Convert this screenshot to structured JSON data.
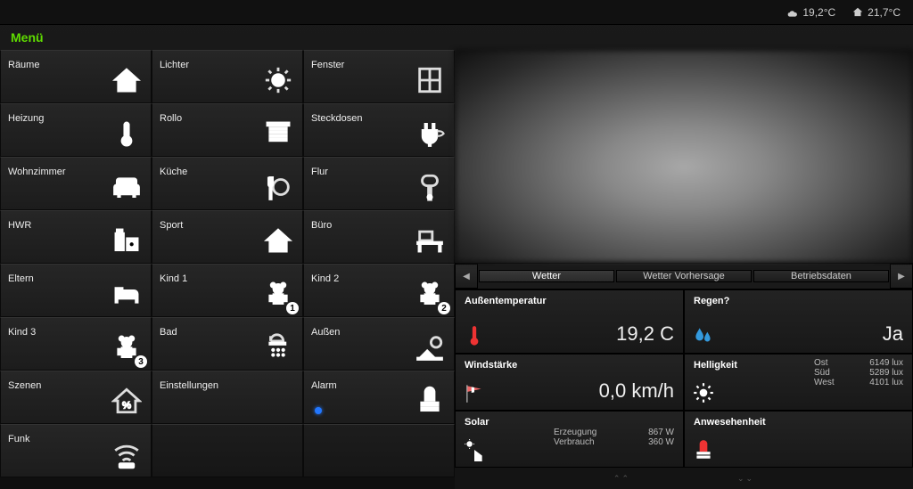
{
  "status": {
    "outdoor": "19,2°C",
    "indoor": "21,7°C"
  },
  "menu": {
    "title": "Menü"
  },
  "tiles": [
    {
      "label": "Räume",
      "icon": "house"
    },
    {
      "label": "Lichter",
      "icon": "bulb"
    },
    {
      "label": "Fenster",
      "icon": "window"
    },
    {
      "label": "Heizung",
      "icon": "thermo"
    },
    {
      "label": "Rollo",
      "icon": "blind"
    },
    {
      "label": "Steckdosen",
      "icon": "plug"
    },
    {
      "label": "Wohnzimmer",
      "icon": "sofa"
    },
    {
      "label": "Küche",
      "icon": "cutlery"
    },
    {
      "label": "Flur",
      "icon": "doorhandle"
    },
    {
      "label": "HWR",
      "icon": "utility"
    },
    {
      "label": "Sport",
      "icon": "house"
    },
    {
      "label": "Büro",
      "icon": "desk"
    },
    {
      "label": "Eltern",
      "icon": "bed"
    },
    {
      "label": "Kind 1",
      "icon": "teddy",
      "badge": "1"
    },
    {
      "label": "Kind 2",
      "icon": "teddy",
      "badge": "2"
    },
    {
      "label": "Kind 3",
      "icon": "teddy",
      "badge": "3"
    },
    {
      "label": "Bad",
      "icon": "shower"
    },
    {
      "label": "Außen",
      "icon": "outdoor"
    },
    {
      "label": "Szenen",
      "icon": "housepct"
    },
    {
      "label": "Einstellungen",
      "icon": ""
    },
    {
      "label": "Alarm",
      "icon": "siren",
      "dot": true
    },
    {
      "label": "Funk",
      "icon": "wifi"
    },
    {
      "label": "",
      "icon": ""
    },
    {
      "label": "",
      "icon": ""
    }
  ],
  "tabs": {
    "items": [
      "Wetter",
      "Wetter Vorhersage",
      "Betriebsdaten"
    ],
    "active": 0
  },
  "weather": {
    "temp": {
      "label": "Außentemperatur",
      "value": "19,2 C"
    },
    "rain": {
      "label": "Regen?",
      "value": "Ja"
    },
    "wind": {
      "label": "Windstärke",
      "value": "0,0 km/h"
    },
    "bright": {
      "label": "Helligkeit",
      "items": [
        {
          "dir": "Ost",
          "val": "6149 lux"
        },
        {
          "dir": "Süd",
          "val": "5289 lux"
        },
        {
          "dir": "West",
          "val": "4101 lux"
        }
      ]
    },
    "solar": {
      "label": "Solar",
      "items": [
        {
          "k": "Erzeugung",
          "v": "867 W"
        },
        {
          "k": "Verbrauch",
          "v": "360 W"
        }
      ]
    },
    "presence": {
      "label": "Anwesehenheit"
    }
  }
}
